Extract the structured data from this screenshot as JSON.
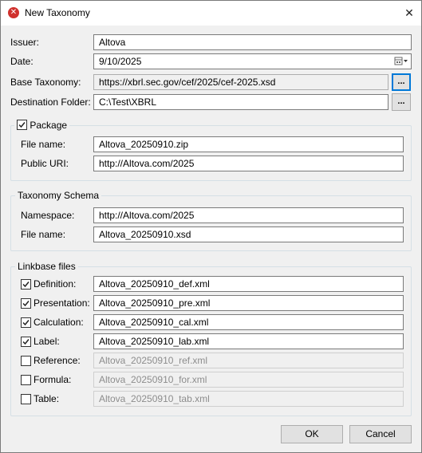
{
  "window": {
    "title": "New Taxonomy"
  },
  "issuer": {
    "label": "Issuer:",
    "value": "Altova"
  },
  "date": {
    "label": "Date:",
    "value": "9/10/2025"
  },
  "base_taxonomy": {
    "label": "Base Taxonomy:",
    "value": "https://xbrl.sec.gov/cef/2025/cef-2025.xsd",
    "browse": "..."
  },
  "destination": {
    "label": "Destination Folder:",
    "value": "C:\\Test\\XBRL",
    "browse": "..."
  },
  "package": {
    "label": "Package",
    "checked": true,
    "file_name_label": "File name:",
    "file_name": "Altova_20250910.zip",
    "uri_label": "Public URI:",
    "uri": "http://Altova.com/2025"
  },
  "schema": {
    "title": "Taxonomy Schema",
    "namespace_label": "Namespace:",
    "namespace": "http://Altova.com/2025",
    "file_name_label": "File name:",
    "file_name": "Altova_20250910.xsd"
  },
  "linkbase": {
    "title": "Linkbase files",
    "items": [
      {
        "label": "Definition:",
        "value": "Altova_20250910_def.xml",
        "checked": true
      },
      {
        "label": "Presentation:",
        "value": "Altova_20250910_pre.xml",
        "checked": true
      },
      {
        "label": "Calculation:",
        "value": "Altova_20250910_cal.xml",
        "checked": true
      },
      {
        "label": "Label:",
        "value": "Altova_20250910_lab.xml",
        "checked": true
      },
      {
        "label": "Reference:",
        "value": "Altova_20250910_ref.xml",
        "checked": false
      },
      {
        "label": "Formula:",
        "value": "Altova_20250910_for.xml",
        "checked": false
      },
      {
        "label": "Table:",
        "value": "Altova_20250910_tab.xml",
        "checked": false
      }
    ]
  },
  "buttons": {
    "ok": "OK",
    "cancel": "Cancel"
  }
}
